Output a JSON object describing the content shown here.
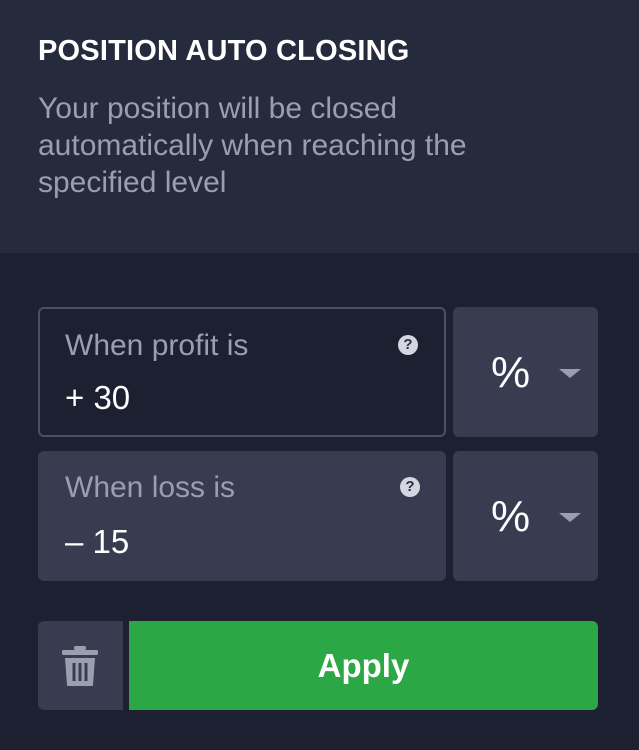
{
  "panel": {
    "title": "POSITION AUTO CLOSING",
    "description": "Your position will be closed automatically when reaching the specified level"
  },
  "profit": {
    "label": "When profit is",
    "value": "+ 30",
    "unit": "%",
    "help_glyph": "?"
  },
  "loss": {
    "label": "When loss is",
    "value": "– 15",
    "unit": "%",
    "help_glyph": "?"
  },
  "actions": {
    "apply_label": "Apply",
    "delete_icon": "trash-icon"
  },
  "colors": {
    "accent_green": "#2ba845",
    "background": "#1d2031",
    "header_background": "#262a3d",
    "field_background": "#383c50"
  }
}
